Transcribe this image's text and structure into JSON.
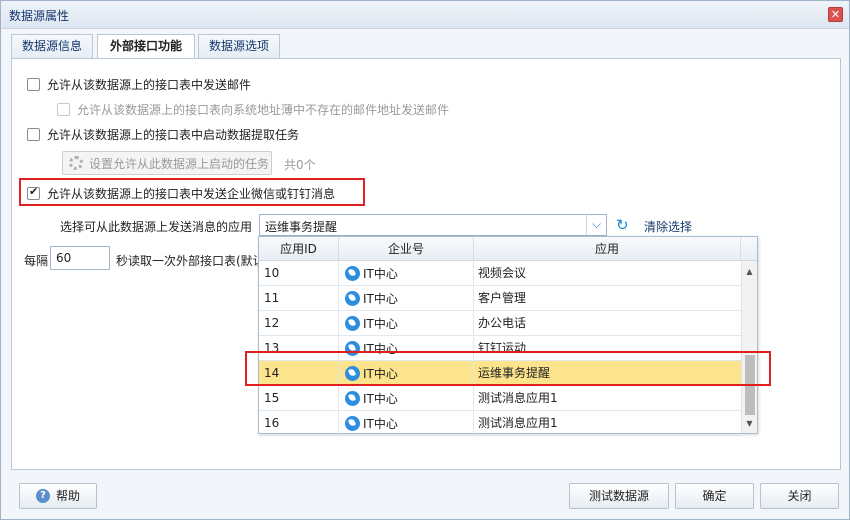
{
  "window": {
    "title": "数据源属性",
    "close_glyph": "✕"
  },
  "tabs": [
    {
      "label": "数据源信息"
    },
    {
      "label": "外部接口功能"
    },
    {
      "label": "数据源选项"
    }
  ],
  "options": {
    "send_mail": "允许从该数据源上的接口表中发送邮件",
    "send_mail_unknown": "允许从该数据源上的接口表向系统地址薄中不存在的邮件地址发送邮件",
    "start_task": "允许从该数据源上的接口表中启动数据提取任务",
    "set_tasks_button": "设置允许从此数据源上启动的任务",
    "task_count": "共0个",
    "send_msg": "允许从该数据源上的接口表中发送企业微信或钉钉消息"
  },
  "app_select": {
    "label": "选择可从此数据源上发送消息的应用",
    "value": "运维事务提醒",
    "arrow": "⌵",
    "refresh_glyph": "↻",
    "clear_label": "清除选择"
  },
  "interval": {
    "prefix": "每隔",
    "value": "60",
    "suffix": "秒读取一次外部接口表(默认"
  },
  "dropdown": {
    "headers": [
      "应用ID",
      "企业号",
      "应用"
    ],
    "rows": [
      {
        "id": "10",
        "corp": "IT中心",
        "app": "视频会议"
      },
      {
        "id": "11",
        "corp": "IT中心",
        "app": "客户管理"
      },
      {
        "id": "12",
        "corp": "IT中心",
        "app": "办公电话"
      },
      {
        "id": "13",
        "corp": "IT中心",
        "app": "钉钉运动"
      },
      {
        "id": "14",
        "corp": "IT中心",
        "app": "运维事务提醒"
      },
      {
        "id": "15",
        "corp": "IT中心",
        "app": "测试消息应用1"
      },
      {
        "id": "16",
        "corp": "IT中心",
        "app": "测试消息应用1"
      }
    ],
    "selected_id": "14"
  },
  "footer": {
    "help": "帮助",
    "test": "测试数据源",
    "ok": "确定",
    "close": "关闭"
  },
  "colors": {
    "highlight": "#fbe48c",
    "red_box": "#e02020",
    "accent": "#2d8ee0"
  }
}
